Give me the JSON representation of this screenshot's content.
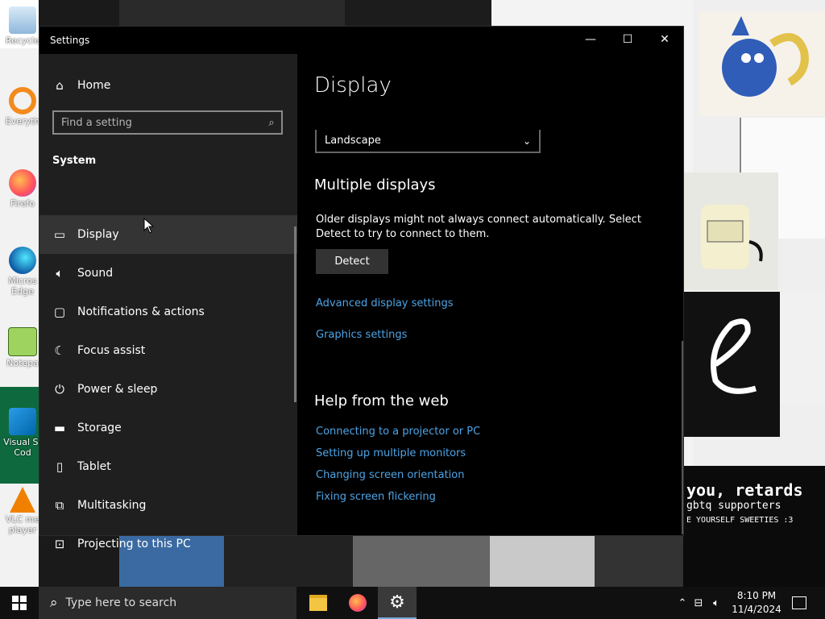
{
  "window": {
    "title": "Settings",
    "controls": {
      "minimize": "—",
      "maximize": "☐",
      "close": "✕"
    }
  },
  "sidebar": {
    "home_label": "Home",
    "search_placeholder": "Find a setting",
    "section_title": "System",
    "items": [
      {
        "label": "Display",
        "icon": "monitor-icon",
        "active": true
      },
      {
        "label": "Sound",
        "icon": "speaker-icon"
      },
      {
        "label": "Notifications & actions",
        "icon": "notification-icon"
      },
      {
        "label": "Focus assist",
        "icon": "moon-icon"
      },
      {
        "label": "Power & sleep",
        "icon": "power-icon"
      },
      {
        "label": "Storage",
        "icon": "storage-icon"
      },
      {
        "label": "Tablet",
        "icon": "tablet-icon"
      },
      {
        "label": "Multitasking",
        "icon": "multitasking-icon"
      },
      {
        "label": "Projecting to this PC",
        "icon": "projector-icon"
      }
    ]
  },
  "content": {
    "page_title": "Display",
    "orientation_value": "Landscape",
    "multiple_displays_heading": "Multiple displays",
    "multiple_displays_text": "Older displays might not always connect automatically. Select Detect to try to connect to them.",
    "detect_button": "Detect",
    "advanced_link": "Advanced display settings",
    "graphics_link": "Graphics settings",
    "help_heading": "Help from the web",
    "help_links": [
      "Connecting to a projector or PC",
      "Setting up multiple monitors",
      "Changing screen orientation",
      "Fixing screen flickering"
    ]
  },
  "desktop_icons": [
    {
      "label": "Recycle",
      "icon": "recycle-bin-icon"
    },
    {
      "label": "Everyth",
      "icon": "everything-search-icon"
    },
    {
      "label": "Firefo",
      "icon": "firefox-icon"
    },
    {
      "label": "Micros Edge",
      "icon": "edge-icon"
    },
    {
      "label": "Notepa",
      "icon": "notepad-icon"
    },
    {
      "label": "Visual St Cod",
      "icon": "vscode-icon"
    },
    {
      "label": "VLC me player",
      "icon": "vlc-icon"
    }
  ],
  "wallpaper_text": {
    "line1": "you, retards",
    "line2": "gbtq supporters",
    "line3": "E YOURSELF SWEETIES :3"
  },
  "taskbar": {
    "search_placeholder": "Type here to search",
    "time": "8:10 PM",
    "date": "11/4/2024"
  },
  "colors": {
    "accent_link": "#4ca4e6",
    "sidebar_bg": "#1f1f1f",
    "content_bg": "#000000",
    "active_item_bg": "#343434"
  }
}
